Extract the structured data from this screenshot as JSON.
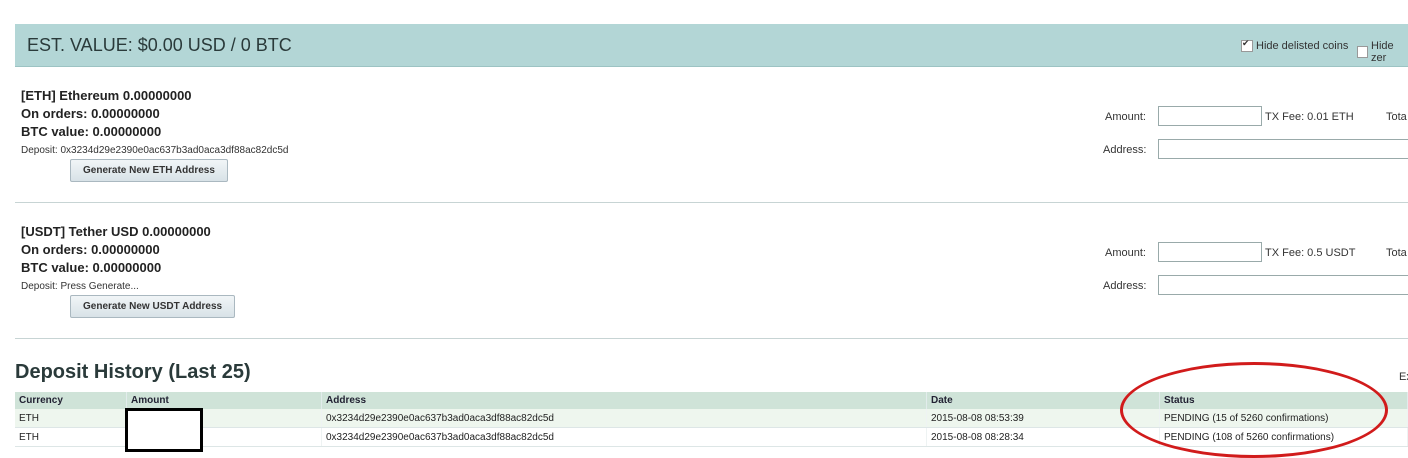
{
  "header": {
    "title": "EST. VALUE: $0.00 USD / 0 BTC",
    "hide_delisted": "Hide delisted coins",
    "hide_zero": "Hide zer"
  },
  "coins": [
    {
      "title": "[ETH] Ethereum 0.00000000",
      "on_orders": "On orders: 0.00000000",
      "btc_value": "BTC value: 0.00000000",
      "deposit": "Deposit: 0x3234d29e2390e0ac637b3ad0aca3df88ac82dc5d",
      "button": "Generate New ETH Address",
      "amount_label": "Amount:",
      "tx_fee": "TX Fee:  0.01 ETH",
      "total_label": "Tota",
      "address_label": "Address:"
    },
    {
      "title": "[USDT] Tether USD 0.00000000",
      "on_orders": "On orders: 0.00000000",
      "btc_value": "BTC value: 0.00000000",
      "deposit": "Deposit: Press Generate...",
      "button": "Generate New USDT Address",
      "amount_label": "Amount:",
      "tx_fee": "TX Fee:  0.5 USDT",
      "total_label": "Tota",
      "address_label": "Address:"
    }
  ],
  "history": {
    "title": "Deposit History (Last 25)",
    "export": "Ex",
    "columns": [
      "Currency",
      "Amount",
      "Address",
      "Date",
      "Status"
    ],
    "rows": [
      [
        "ETH",
        "",
        "0x3234d29e2390e0ac637b3ad0aca3df88ac82dc5d",
        "2015-08-08 08:53:39",
        "PENDING (15 of 5260 confirmations)"
      ],
      [
        "ETH",
        "",
        "0x3234d29e2390e0ac637b3ad0aca3df88ac82dc5d",
        "2015-08-08 08:28:34",
        "PENDING (108 of 5260 confirmations)"
      ]
    ]
  }
}
